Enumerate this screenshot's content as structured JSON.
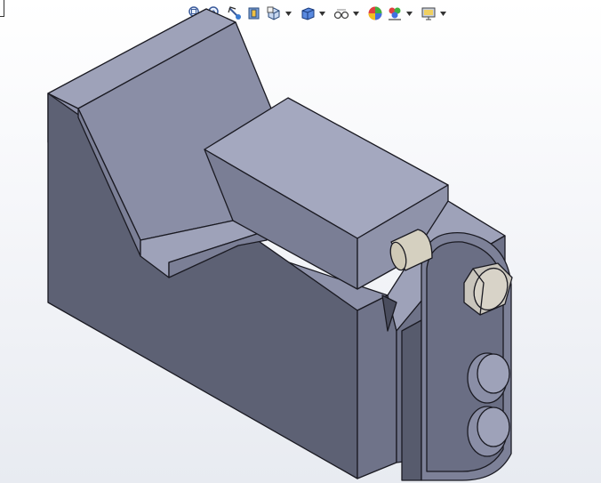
{
  "app": {
    "title": ""
  },
  "toolbar": {
    "buttons": [
      {
        "icon": "zoom-to-fit-icon",
        "has_dropdown": false
      },
      {
        "icon": "zoom-to-area-icon",
        "has_dropdown": false
      },
      {
        "icon": "previous-view-icon",
        "has_dropdown": false
      },
      {
        "icon": "section-view-icon",
        "has_dropdown": false
      },
      {
        "icon": "view-orientation-icon",
        "has_dropdown": true
      },
      {
        "icon": "display-style-icon",
        "has_dropdown": true
      },
      {
        "icon": "hide-show-items-icon",
        "has_dropdown": true
      },
      {
        "icon": "edit-appearance-icon",
        "has_dropdown": false
      },
      {
        "icon": "apply-scene-icon",
        "has_dropdown": true
      },
      {
        "icon": "view-settings-icon",
        "has_dropdown": true
      }
    ]
  },
  "colors": {
    "part_light": "#a3a7be",
    "part_mid": "#8a8ea6",
    "part_dark": "#5c6072",
    "part_darkest": "#4a4d5e",
    "edge": "#1a1a22",
    "bolt": "#c9c5bc",
    "pin": "#d8d3c4"
  }
}
